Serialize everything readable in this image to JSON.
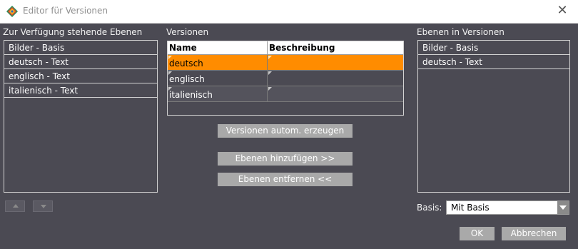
{
  "window": {
    "title": "Editor für Versionen",
    "close_glyph": "✕"
  },
  "left_panel": {
    "label": "Zur Verfügung stehende Ebenen",
    "items": [
      "Bilder - Basis",
      "deutsch - Text",
      "englisch - Text",
      "italienisch - Text"
    ]
  },
  "versions": {
    "label": "Versionen",
    "columns": [
      "Name",
      "Beschreibung"
    ],
    "rows": [
      {
        "name": "deutsch",
        "description": ""
      },
      {
        "name": "englisch",
        "description": ""
      },
      {
        "name": "italienisch",
        "description": ""
      }
    ],
    "selected_row": "deutsch"
  },
  "buttons": {
    "auto_create": "Versionen autom. erzeugen",
    "add_layers": "Ebenen hinzufügen >>",
    "remove_layers": "Ebenen entfernen <<",
    "ok": "OK",
    "cancel": "Abbrechen"
  },
  "right_panel": {
    "label": "Ebenen in Versionen",
    "items": [
      "Bilder - Basis",
      "deutsch - Text"
    ]
  },
  "basis": {
    "label": "Basis:",
    "value": "Mit Basis"
  },
  "colors": {
    "background": "#4b4a53",
    "selection": "#ff8c00",
    "button": "#a9a9a9",
    "border": "#d3d3d3"
  }
}
